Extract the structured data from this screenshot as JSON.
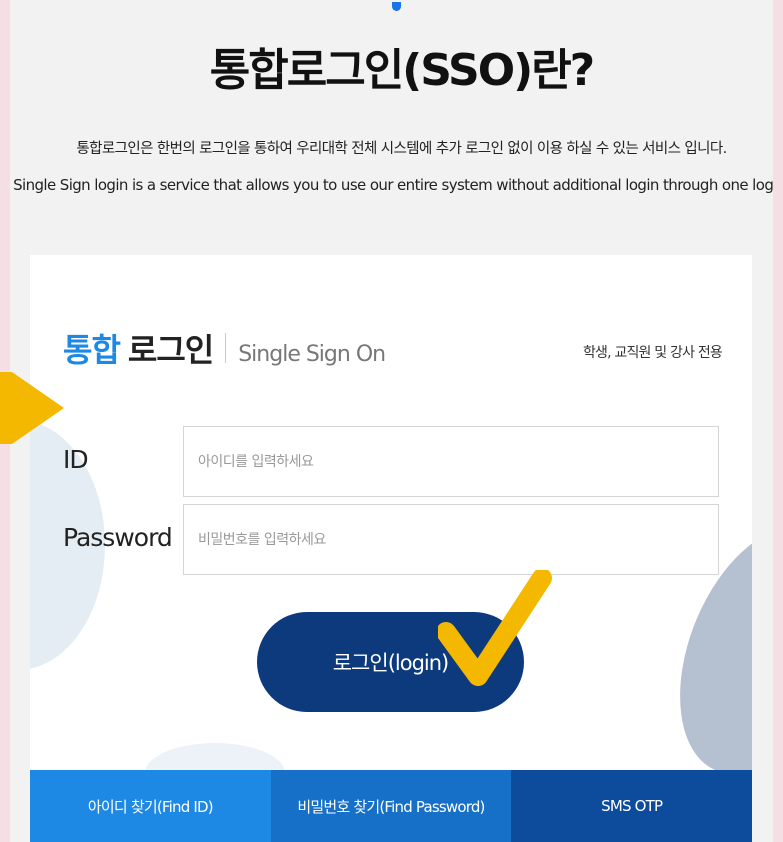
{
  "page": {
    "title": "통합로그인(SSO)란?",
    "description_ko": "통합로그인은 한번의 로그인을 통하여 우리대학 전체 시스템에 추가 로그인 없이 이용 하실 수 있는 서비스 입니다.",
    "description_en": "Single Sign login is a service that allows you to use our entire system without additional login through one login."
  },
  "login_card": {
    "heading_accent": "통합",
    "heading_main": "로그인",
    "heading_sub": "Single Sign On",
    "user_note": "학생, 교직원 및 강사 전용",
    "id_label": "ID",
    "id_placeholder": "아이디를 입력하세요",
    "password_label": "Password",
    "password_placeholder": "비밀번호를 입력하세요",
    "login_button": "로그인(login)"
  },
  "tabs": [
    {
      "label": "아이디 찾기(Find ID)"
    },
    {
      "label": "비밀번호 찾기(Find Password)"
    },
    {
      "label": "SMS OTP"
    }
  ],
  "annotations": {
    "checkmark_icon": "check-icon",
    "arrow_icon": "arrow-right-icon",
    "accent_color": "#1e88e5",
    "button_color": "#0d3a7c",
    "annotation_color": "#f5b800"
  }
}
